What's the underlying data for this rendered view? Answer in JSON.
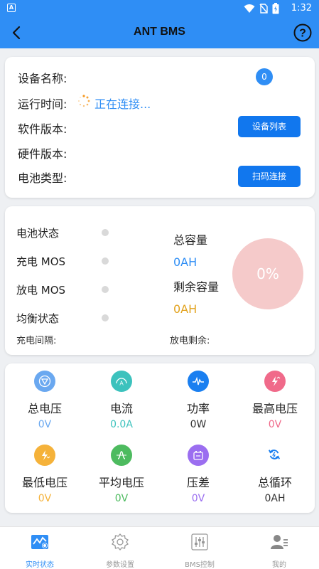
{
  "status_bar": {
    "time": "1:32",
    "app_badge": "A"
  },
  "app_bar": {
    "title": "ANT BMS"
  },
  "device_info": {
    "device_name_label": "设备名称:",
    "device_count": "0",
    "run_time_label": "运行时间:",
    "connecting_text": "正在连接...",
    "software_version_label": "软件版本:",
    "hardware_version_label": "硬件版本:",
    "battery_type_label": "电池类型:",
    "device_list_button": "设备列表",
    "scan_connect_button": "扫码连接"
  },
  "battery_status": {
    "battery_state_label": "电池状态",
    "charge_mos_label": "充电 MOS",
    "discharge_mos_label": "放电 MOS",
    "balance_label": "均衡状态",
    "charge_interval_label": "充电间隔:",
    "discharge_remaining_label": "放电剩余:",
    "total_capacity_label": "总容量",
    "total_capacity_value": "0AH",
    "remaining_capacity_label": "剩余容量",
    "remaining_capacity_value": "0AH",
    "soc": "0%"
  },
  "metrics": [
    {
      "label": "总电压",
      "value": "0V",
      "icon": "triangle-gauge-icon",
      "color": "#6aa8f0"
    },
    {
      "label": "电流",
      "value": "0.0A",
      "icon": "ammeter-icon",
      "color": "#3cc2bd"
    },
    {
      "label": "功率",
      "value": "0W",
      "icon": "waveform-icon",
      "color": "#1a7ff0"
    },
    {
      "label": "最高电压",
      "value": "0V",
      "icon": "lightning-up-icon",
      "color": "#f06a8a"
    },
    {
      "label": "最低电压",
      "value": "0V",
      "icon": "lightning-down-icon",
      "color": "#f5b23a"
    },
    {
      "label": "平均电压",
      "value": "0V",
      "icon": "sine-wave-icon",
      "color": "#4dbb5f"
    },
    {
      "label": "压差",
      "value": "0V",
      "icon": "battery-diff-icon",
      "color": "#9b6ef0"
    },
    {
      "label": "总循环",
      "value": "0AH",
      "icon": "cycle-icon",
      "color": "#1a7ff0"
    }
  ],
  "bottom_nav": [
    {
      "label": "实时状态"
    },
    {
      "label": "参数设置"
    },
    {
      "label": "BMS控制"
    },
    {
      "label": "我的"
    }
  ],
  "colors": {
    "primary": "#2f8ef5",
    "button": "#1177ee",
    "soc_circle": "#f5caca",
    "total_capacity_value": "#2f8ef5",
    "remaining_capacity_value": "#e2a21d"
  }
}
